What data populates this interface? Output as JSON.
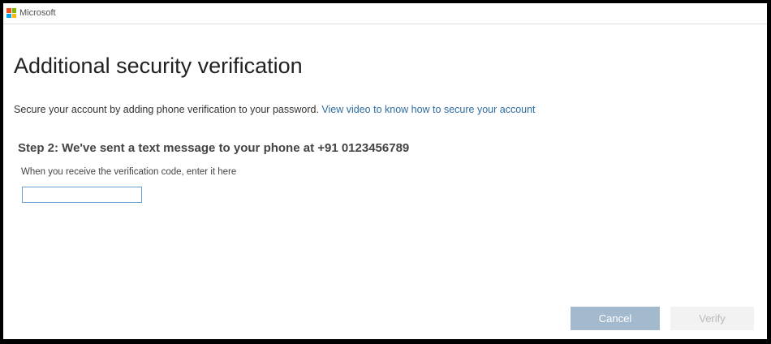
{
  "header": {
    "brand": "Microsoft",
    "logo_colors": [
      "#f25022",
      "#7fba00",
      "#00a4ef",
      "#ffb900"
    ]
  },
  "main": {
    "title": "Additional security verification",
    "intro_text": "Secure your account by adding phone verification to your password.",
    "intro_link": "View video to know how to secure your account",
    "step_heading": "Step 2: We've sent a text message to your phone at +91 0123456789",
    "code_label": "When you receive the verification code, enter it here",
    "code_value": ""
  },
  "actions": {
    "cancel_label": "Cancel",
    "verify_label": "Verify"
  }
}
